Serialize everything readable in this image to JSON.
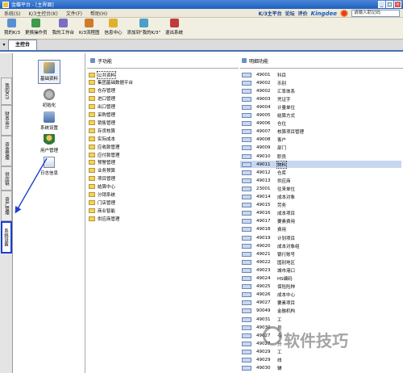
{
  "window": {
    "title": "金蝶平台 - [主界面]"
  },
  "menu": {
    "items": [
      "系统(S)",
      "K/3主控台(K)",
      "文件(F)",
      "帮助(H)"
    ],
    "links": [
      "K/3主平台",
      "论坛",
      "评价"
    ],
    "brand": "Kingdee",
    "hint_placeholder": "请输入助记码"
  },
  "toolbar": {
    "buttons": [
      {
        "label": "我的K/3",
        "icon": "home-icon",
        "color": "#5a8fd6"
      },
      {
        "label": "更换操作员",
        "icon": "user-switch-icon",
        "color": "#3f9a4a"
      },
      {
        "label": "我的工作台",
        "icon": "desk-icon",
        "color": "#7a6fc4"
      },
      {
        "label": "K/3流程图",
        "icon": "flowchart-icon",
        "color": "#d07b2c"
      },
      {
        "label": "信息中心",
        "icon": "message-icon",
        "color": "#e0b12e"
      },
      {
        "label": "添加到\"我的K/3\"",
        "icon": "add-icon",
        "color": "#4aa0c8"
      },
      {
        "label": "退出系统",
        "icon": "exit-icon",
        "color": "#c23b3b"
      }
    ]
  },
  "tabs": {
    "main": "主控台"
  },
  "rail": {
    "tabs": [
      "我的K/3",
      "财务会计",
      "资金管理",
      "供应链",
      "资产管理",
      "系统设置"
    ],
    "active_index": 5
  },
  "modules": [
    {
      "label": "基础资料",
      "icon": "base-data-icon",
      "selected": true
    },
    {
      "label": "初始化",
      "icon": "init-icon",
      "selected": false
    },
    {
      "label": "系统设置",
      "icon": "settings-icon",
      "selected": false
    },
    {
      "label": "用户管理",
      "icon": "user-icon",
      "selected": false
    },
    {
      "label": "日志信息",
      "icon": "log-icon",
      "selected": false
    }
  ],
  "subfunc": {
    "header": "子功能",
    "items": [
      "公共资料",
      "集团基础数据平台",
      "仓存管理",
      "进口管理",
      "出口管理",
      "采购管理",
      "销售管理",
      "存货核算",
      "实际成本",
      "应收款管理",
      "应付款管理",
      "预警管理",
      "业务预算",
      "项目管理",
      "结算中心",
      "分销系统",
      "门店管理",
      "商业智能",
      "供应商管理"
    ],
    "selected_index": 0
  },
  "objects": {
    "header": "明细功能",
    "rows": [
      {
        "code": "49001",
        "name": "科目"
      },
      {
        "code": "49002",
        "name": "币别"
      },
      {
        "code": "49002",
        "name": "汇率体系"
      },
      {
        "code": "49003",
        "name": "凭证字"
      },
      {
        "code": "49004",
        "name": "计量单位"
      },
      {
        "code": "49005",
        "name": "结算方式"
      },
      {
        "code": "49006",
        "name": "仓位"
      },
      {
        "code": "49007",
        "name": "核算项目管理"
      },
      {
        "code": "49008",
        "name": "客户"
      },
      {
        "code": "49009",
        "name": "部门"
      },
      {
        "code": "49010",
        "name": "职员"
      },
      {
        "code": "49011",
        "name": "物料"
      },
      {
        "code": "49012",
        "name": "仓库"
      },
      {
        "code": "49013",
        "name": "供应商"
      },
      {
        "code": "23001",
        "name": "往来单位"
      },
      {
        "code": "49014",
        "name": "成本对象"
      },
      {
        "code": "49015",
        "name": "劳务"
      },
      {
        "code": "49016",
        "name": "成本项目"
      },
      {
        "code": "49017",
        "name": "要素费用"
      },
      {
        "code": "49018",
        "name": "费用"
      },
      {
        "code": "49019",
        "name": "计划项目"
      },
      {
        "code": "49020",
        "name": "成本对象组"
      },
      {
        "code": "49021",
        "name": "银行账号"
      },
      {
        "code": "49022",
        "name": "国别地区"
      },
      {
        "code": "49023",
        "name": "城市港口"
      },
      {
        "code": "49024",
        "name": "HS编码"
      },
      {
        "code": "49025",
        "name": "保险险种"
      },
      {
        "code": "49026",
        "name": "成本中心"
      },
      {
        "code": "49027",
        "name": "要素项目"
      },
      {
        "code": "90049",
        "name": "金融机构"
      },
      {
        "code": "49031",
        "name": "工"
      },
      {
        "code": "49030",
        "name": "员"
      },
      {
        "code": "49027",
        "name": "专"
      },
      {
        "code": "49027",
        "name": "分"
      },
      {
        "code": "49029",
        "name": "工"
      },
      {
        "code": "49029",
        "name": "线"
      },
      {
        "code": "49030",
        "name": "辅"
      }
    ],
    "selected_index": 11
  },
  "watermark": "软件技巧"
}
